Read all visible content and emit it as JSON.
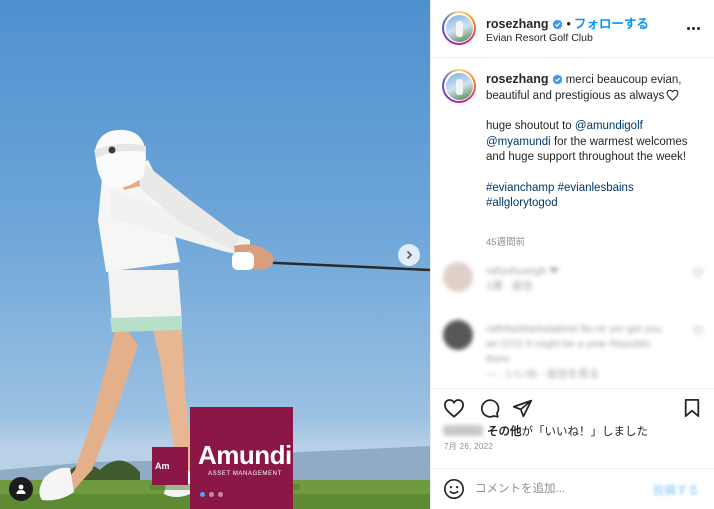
{
  "photo": {
    "sign_brand": "Amundi",
    "sign_sub": "ASSET MANAGEMENT",
    "small_sign_text": "Am",
    "carousel_dots": 3,
    "active_dot": 0
  },
  "header": {
    "username": "rosezhang",
    "separator": "•",
    "follow_label": "フォローする",
    "location": "Evian Resort Golf Club"
  },
  "caption": {
    "username": "rosezhang",
    "line1": "merci beaucoup evian, beautiful and prestigious as always",
    "shoutout_prefix": "huge shoutout to",
    "mention1": "@amundigolf",
    "mention2": "@myamundi",
    "shoutout_suffix": "for the warmest welcomes and huge support throughout the week!",
    "hashtag1": "#evianchamp",
    "hashtag2": "#evianlesbains",
    "hashtag3": "#allglorytogod",
    "time_ago": "45週間前"
  },
  "comments": [
    {
      "text": "rafiyohuangh ❤",
      "meta": "1週 · 返信"
    },
    {
      "text": "raffrttarbtarbalabnet fla nir yer get you an OTG it might be a year Republic there",
      "meta": "— · いいね · 返信を見る"
    }
  ],
  "likes": {
    "other_label": "その他",
    "suffix": "が「いいね！」しました",
    "date": "7月 26, 2022"
  },
  "composer": {
    "placeholder": "コメントを追加...",
    "post_label": "投稿する"
  },
  "colors": {
    "link": "#00376b",
    "follow": "#0095f6",
    "sign": "#8a1745"
  }
}
